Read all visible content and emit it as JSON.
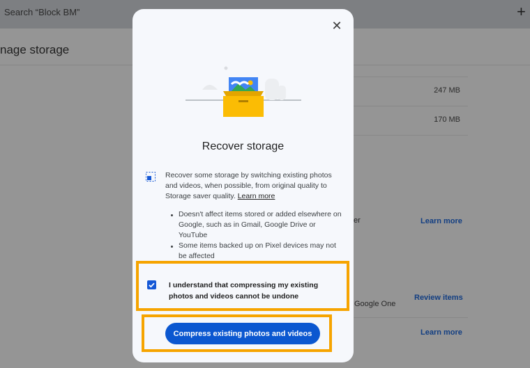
{
  "background": {
    "search_text": "Search “Block BM”",
    "add_icon": "plus-icon",
    "page_title": "nage storage",
    "rows": [
      {
        "size": "247 MB"
      },
      {
        "size": "170 MB"
      }
    ],
    "fragment_er": "er",
    "fragment_google_one": "Google One",
    "learn_more_1": "Learn more",
    "review_items": "Review items",
    "learn_more_2": "Learn more"
  },
  "dialog": {
    "close_icon": "close-icon",
    "title": "Recover storage",
    "info_icon": "compress-image-icon",
    "info_text": "Recover some storage by switching existing photos and videos, when possible, from original quality to Storage saver quality.",
    "learn_more": "Learn more",
    "bullets": [
      "Doesn't affect items stored or added elsewhere on Google, such as in Gmail, Google Drive or YouTube",
      "Some items backed up on Pixel devices may not be affected"
    ],
    "checkbox_label": "I understand that compressing my existing photos and videos cannot be undone",
    "checkbox_checked": true,
    "compress_button": "Compress existing photos and videos"
  },
  "colors": {
    "accent": "#0b57d0",
    "highlight": "#f6a400",
    "overlay": "#959595"
  }
}
